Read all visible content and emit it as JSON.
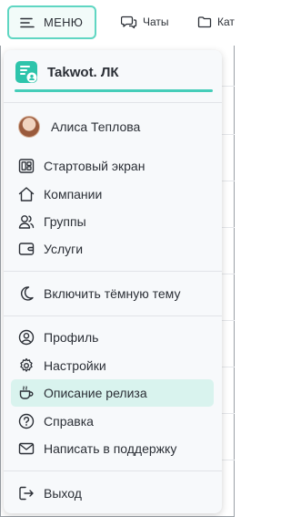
{
  "topbar": {
    "menu_label": "МЕНЮ",
    "chats_label": "Чаты",
    "catalog_label": "Кат"
  },
  "brand": {
    "name": "Takwot. ЛК",
    "accent": "#45cdb9"
  },
  "user": {
    "name": "Алиса Теплова"
  },
  "menu": {
    "start_screen": "Стартовый экран",
    "companies": "Компании",
    "groups": "Группы",
    "services": "Услуги",
    "dark_theme": "Включить тёмную тему",
    "profile": "Профиль",
    "settings": "Настройки",
    "release_notes": "Описание релиза",
    "help": "Справка",
    "support": "Написать в поддержку",
    "logout": "Выход"
  },
  "colors": {
    "active_bg": "#d9f3ee",
    "menu_btn_border": "#5fd6c2"
  }
}
